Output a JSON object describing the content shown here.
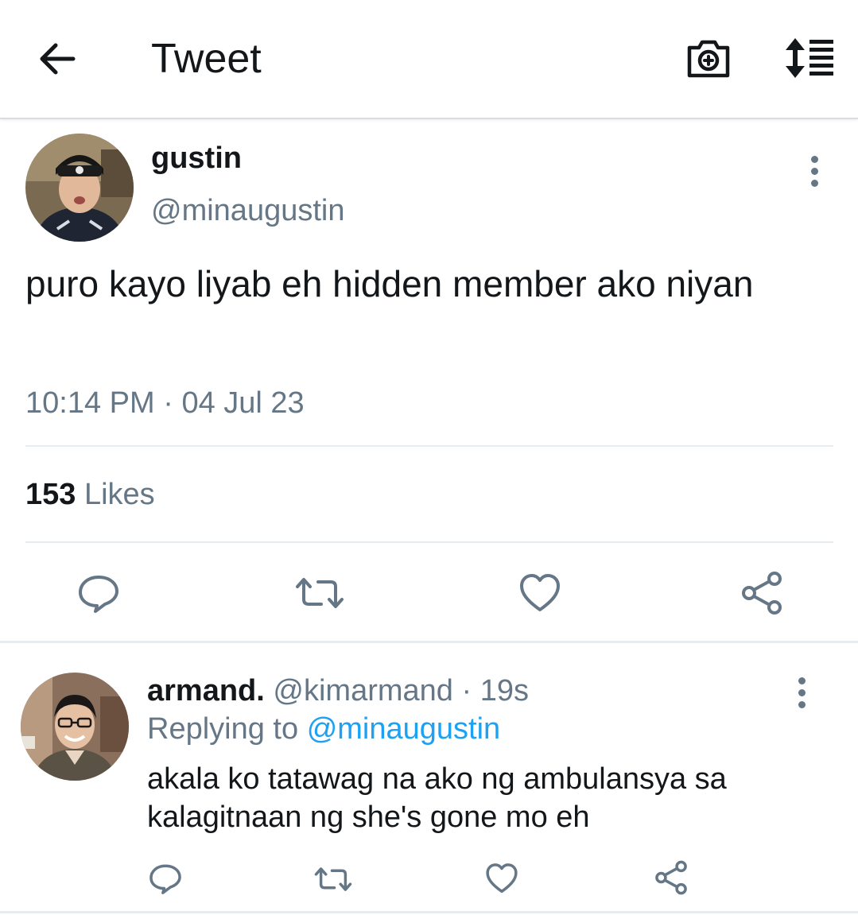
{
  "header": {
    "title": "Tweet",
    "back_icon": "arrow-left-icon",
    "camera_icon": "camera-plus-icon",
    "sort_icon": "sort-list-icon"
  },
  "tweet": {
    "author_name": "gustin",
    "author_handle": "@minaugustin",
    "text": "puro kayo liyab eh hidden member ako niyan",
    "time": "10:14 PM",
    "separator": "·",
    "date": "04 Jul 23",
    "likes_count": "153",
    "likes_label": "Likes"
  },
  "reply": {
    "author_name": "armand.",
    "author_handle": "@kimarmand",
    "separator": "·",
    "age": "19s",
    "replying_to_label": "Replying to",
    "replying_to_handle": "@minaugustin",
    "text": "akala ko tatawag na ako ng ambulansya sa kalagitnaan ng she's gone mo eh"
  },
  "colors": {
    "text_primary": "#14171a",
    "text_secondary": "#657786",
    "accent": "#1da1f2",
    "divider": "#e6ecf0"
  }
}
